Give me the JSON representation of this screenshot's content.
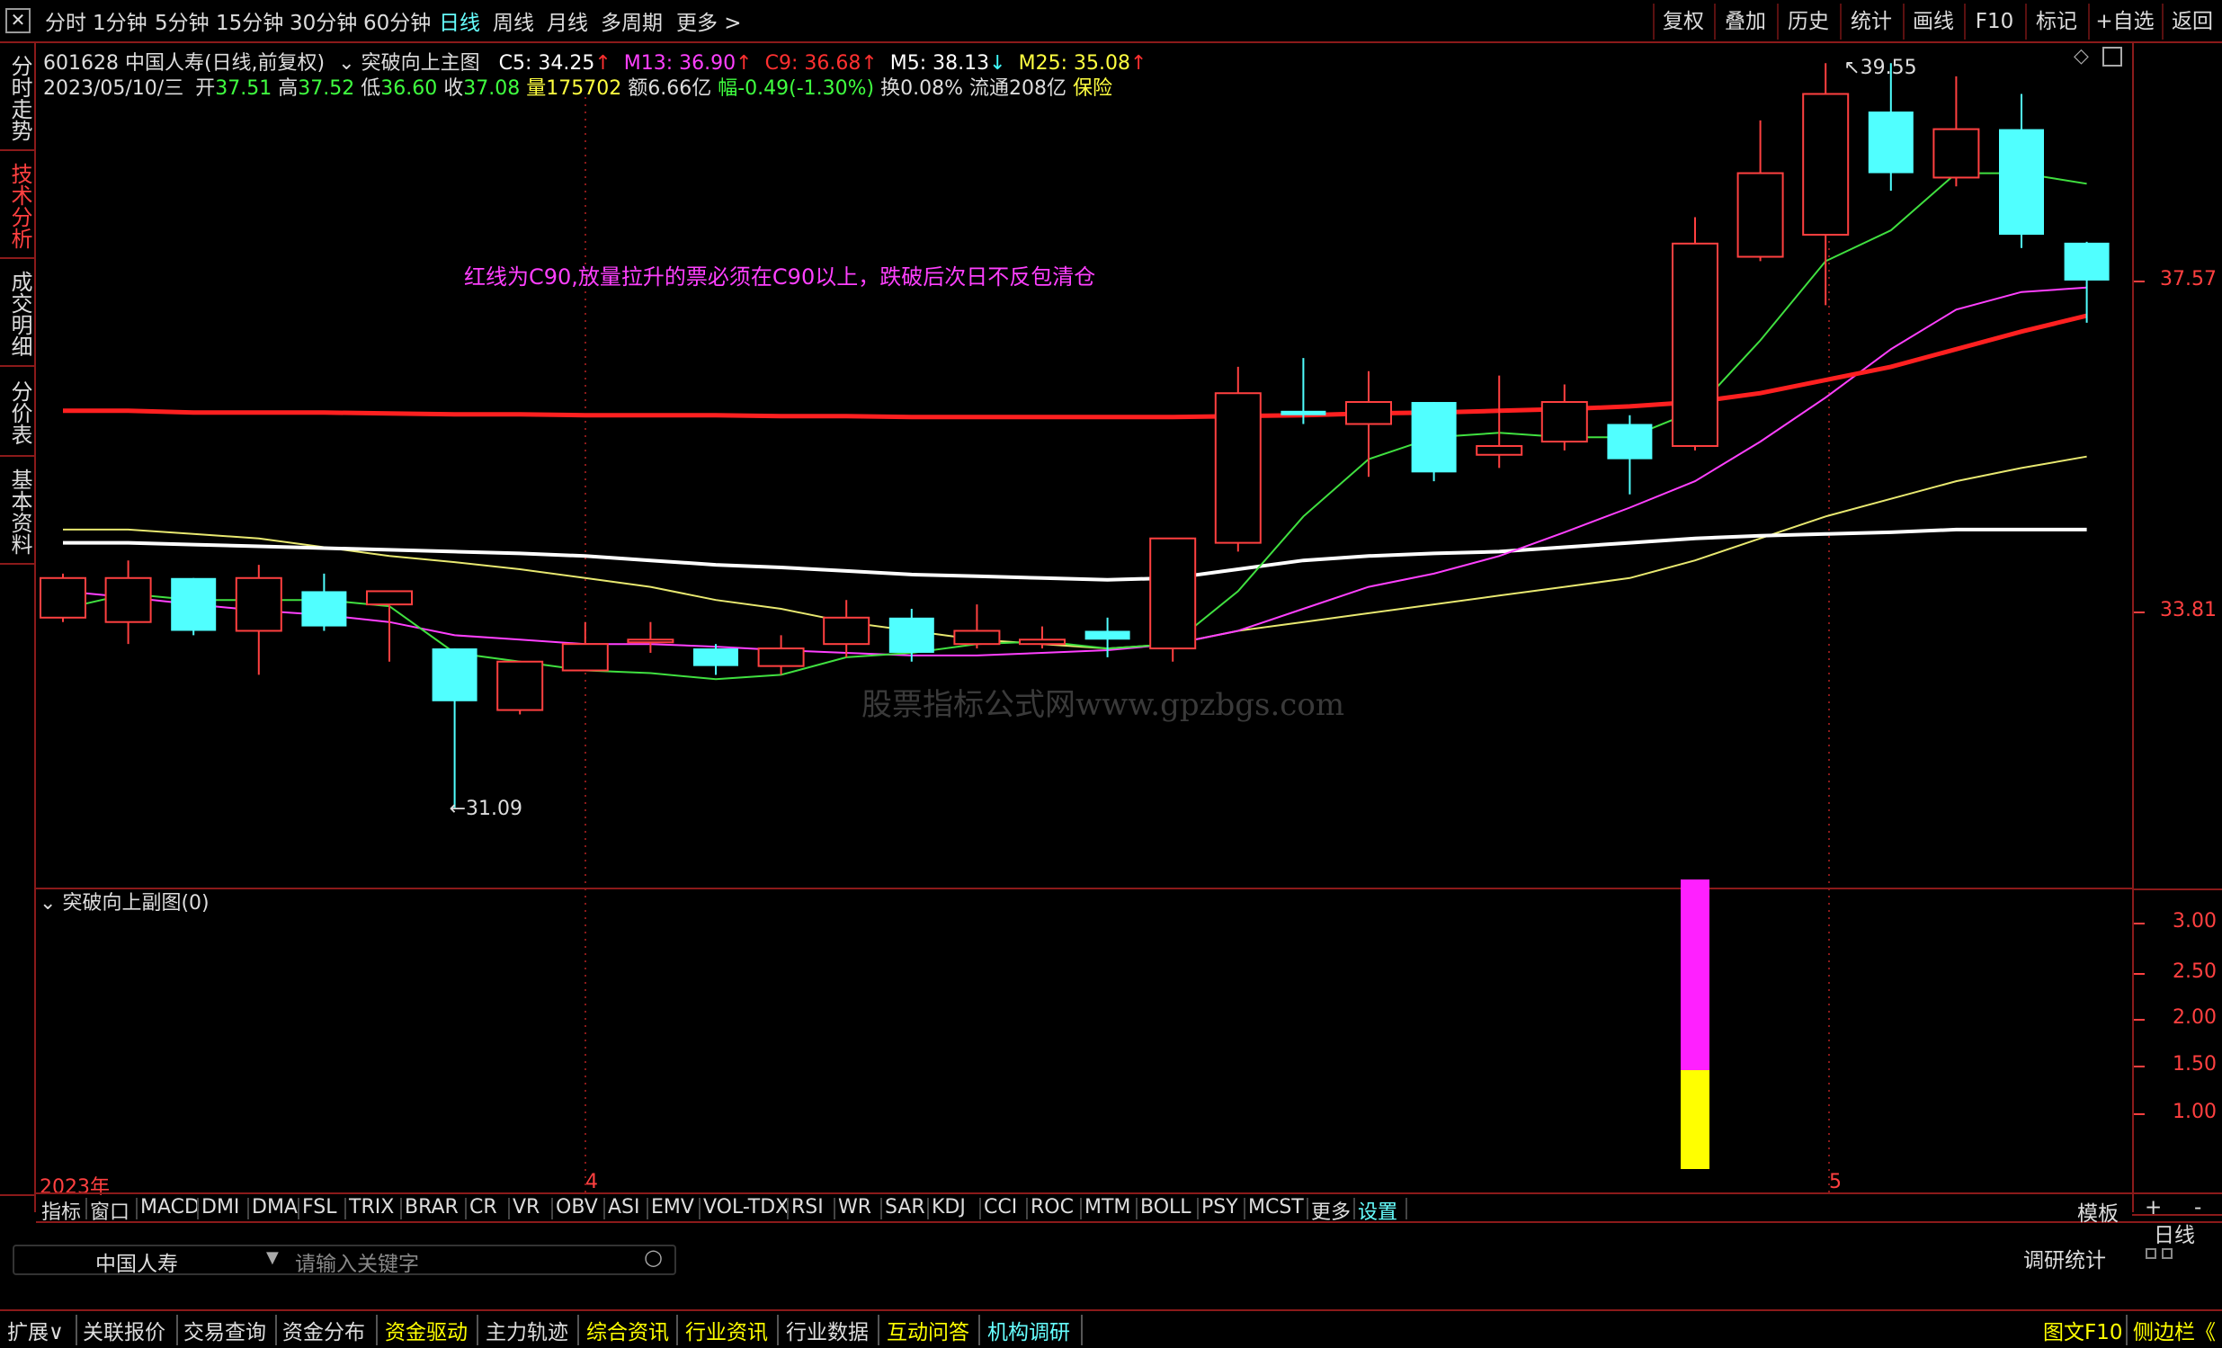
{
  "toolbar": {
    "close_label": "✕",
    "periods": [
      "分时",
      "1分钟",
      "5分钟",
      "15分钟",
      "30分钟",
      "60分钟",
      "日线",
      "周线",
      "月线",
      "多周期",
      "更多 >"
    ],
    "active_period": "日线",
    "right_buttons": [
      "复权",
      "叠加",
      "历史",
      "统计",
      "画线",
      "F10",
      "标记",
      "+自选",
      "返回"
    ]
  },
  "left_tabs": [
    "分时走势",
    "技术分析",
    "成交明细",
    "分价表",
    "基本资料"
  ],
  "active_left_tab": "技术分析",
  "header": {
    "stock": "601628 中国人寿(日线,前复权)",
    "main_chart_name": "突破向上主图",
    "ma": [
      {
        "text": "C5: 34.25",
        "arrow": "↑",
        "color": "#ffffff"
      },
      {
        "text": "M13: 36.90",
        "arrow": "↑",
        "color": "#ff40ff"
      },
      {
        "text": "C9: 36.68",
        "arrow": "↑",
        "color": "#ff3030"
      },
      {
        "text": "M5: 38.13",
        "arrow": "↓",
        "color": "#ffffff"
      },
      {
        "text": "M25: 35.08",
        "arrow": "↑",
        "color": "#ffff40"
      }
    ],
    "date": "2023/05/10/三",
    "open_label": "开",
    "open": "37.51",
    "high_label": "高",
    "high": "37.52",
    "low_label": "低",
    "low": "36.60",
    "close_label": "收",
    "close": "37.08",
    "vol_label": "量",
    "vol": "175702",
    "amount": "额6.66亿",
    "change": "幅-0.49(-1.30%)",
    "turnover": "换0.08%",
    "float": "流通208亿",
    "sector": "保险"
  },
  "annotation": "红线为C90,放量拉升的票必须在C90以上，跌破后次日不反包清仓",
  "watermark": "股票指标公式网www.gpzbgs.com",
  "high_mark": "39.55",
  "low_mark": "31.09",
  "main_axis_labels": [
    "37.57",
    "33.81"
  ],
  "sub_chart_title": "突破向上副图(0)",
  "sub_axis_labels": [
    "3.00",
    "2.50",
    "2.00",
    "1.50",
    "1.00"
  ],
  "time_labels": [
    "2023年",
    "4",
    "5"
  ],
  "period_label_right": "日线",
  "indicators": [
    "指标",
    "窗口",
    "MACD",
    "DMI",
    "DMA",
    "FSL",
    "TRIX",
    "BRAR",
    "CR",
    "VR",
    "OBV",
    "ASI",
    "EMV",
    "VOL-TDX",
    "RSI",
    "WR",
    "SAR",
    "KDJ",
    "CCI",
    "ROC",
    "MTM",
    "BOLL",
    "PSY",
    "MCST",
    "更多",
    "设置"
  ],
  "template_label": "模板",
  "plus_label": "+",
  "minus_label": "-",
  "search": {
    "stock_name": "中国人寿",
    "placeholder": "请输入关键字",
    "right_label": "调研统计"
  },
  "bottom_tabs": [
    "扩展∨",
    "关联报价",
    "交易查询",
    "资金分布",
    "资金驱动",
    "主力轨迹",
    "综合资讯",
    "行业资讯",
    "行业数据",
    "互动问答",
    "机构调研"
  ],
  "bottom_right": [
    "图文F10",
    "侧边栏《"
  ],
  "chart_data": {
    "type": "candlestick",
    "candles": [
      {
        "o": 33.25,
        "c": 33.7,
        "h": 33.75,
        "l": 33.2
      },
      {
        "o": 33.2,
        "c": 33.7,
        "h": 33.9,
        "l": 32.95
      },
      {
        "o": 33.7,
        "c": 33.1,
        "h": 33.7,
        "l": 33.05
      },
      {
        "o": 33.1,
        "c": 33.7,
        "h": 33.85,
        "l": 32.6
      },
      {
        "o": 33.55,
        "c": 33.15,
        "h": 33.75,
        "l": 33.1
      },
      {
        "o": 33.4,
        "c": 33.55,
        "h": 33.55,
        "l": 32.75
      },
      {
        "o": 32.9,
        "c": 32.3,
        "h": 32.9,
        "l": 31.09
      },
      {
        "o": 32.2,
        "c": 32.75,
        "h": 32.75,
        "l": 32.15
      },
      {
        "o": 32.65,
        "c": 32.95,
        "h": 33.2,
        "l": 32.65
      },
      {
        "o": 33.0,
        "c": 33.0,
        "h": 33.2,
        "l": 32.85
      },
      {
        "o": 32.9,
        "c": 32.7,
        "h": 32.95,
        "l": 32.6
      },
      {
        "o": 32.7,
        "c": 32.9,
        "h": 33.05,
        "l": 32.6
      },
      {
        "o": 32.95,
        "c": 33.25,
        "h": 33.45,
        "l": 32.8
      },
      {
        "o": 33.25,
        "c": 32.85,
        "h": 33.35,
        "l": 32.75
      },
      {
        "o": 32.95,
        "c": 33.1,
        "h": 33.4,
        "l": 32.9
      },
      {
        "o": 32.95,
        "c": 33.0,
        "h": 33.15,
        "l": 32.9
      },
      {
        "o": 33.1,
        "c": 33.0,
        "h": 33.25,
        "l": 32.8
      },
      {
        "o": 32.9,
        "c": 34.15,
        "h": 34.15,
        "l": 32.75
      },
      {
        "o": 34.1,
        "c": 35.8,
        "h": 36.1,
        "l": 34.0
      },
      {
        "o": 35.6,
        "c": 35.55,
        "h": 36.2,
        "l": 35.45
      },
      {
        "o": 35.45,
        "c": 35.7,
        "h": 36.05,
        "l": 34.85
      },
      {
        "o": 35.7,
        "c": 34.9,
        "h": 35.7,
        "l": 34.8
      },
      {
        "o": 35.1,
        "c": 35.2,
        "h": 36.0,
        "l": 34.95
      },
      {
        "o": 35.25,
        "c": 35.7,
        "h": 35.9,
        "l": 35.15
      },
      {
        "o": 35.45,
        "c": 35.05,
        "h": 35.55,
        "l": 34.65
      },
      {
        "o": 35.2,
        "c": 37.5,
        "h": 37.8,
        "l": 35.15
      },
      {
        "o": 37.35,
        "c": 38.3,
        "h": 38.9,
        "l": 37.3
      },
      {
        "o": 37.6,
        "c": 39.2,
        "h": 39.55,
        "l": 36.8
      },
      {
        "o": 39.0,
        "c": 38.3,
        "h": 39.55,
        "l": 38.1
      },
      {
        "o": 38.25,
        "c": 38.8,
        "h": 39.4,
        "l": 38.15
      },
      {
        "o": 38.8,
        "c": 37.6,
        "h": 39.2,
        "l": 37.45
      },
      {
        "o": 37.51,
        "c": 37.08,
        "h": 37.52,
        "l": 36.6
      }
    ],
    "ma_green": [
      33.35,
      33.52,
      33.45,
      33.45,
      33.45,
      33.38,
      32.85,
      32.75,
      32.65,
      32.62,
      32.55,
      32.6,
      32.8,
      32.85,
      32.95,
      32.98,
      32.9,
      32.95,
      33.55,
      34.4,
      35.05,
      35.3,
      35.35,
      35.3,
      35.3,
      35.6,
      36.4,
      37.3,
      37.65,
      38.3,
      38.3,
      38.18
    ],
    "ma_magenta": [
      33.55,
      33.48,
      33.4,
      33.33,
      33.28,
      33.2,
      33.05,
      33.0,
      32.95,
      32.95,
      32.92,
      32.88,
      32.85,
      32.82,
      32.82,
      32.85,
      32.88,
      32.95,
      33.1,
      33.35,
      33.6,
      33.75,
      33.95,
      34.22,
      34.5,
      34.8,
      35.25,
      35.75,
      36.3,
      36.75,
      36.95,
      37.0
    ],
    "ma_red": [
      35.6,
      35.6,
      35.58,
      35.58,
      35.58,
      35.57,
      35.56,
      35.56,
      35.55,
      35.55,
      35.55,
      35.54,
      35.54,
      35.53,
      35.53,
      35.53,
      35.53,
      35.53,
      35.54,
      35.55,
      35.57,
      35.58,
      35.6,
      35.62,
      35.65,
      35.7,
      35.8,
      35.95,
      36.1,
      36.3,
      36.5,
      36.68
    ],
    "ma_yellow": [
      34.25,
      34.25,
      34.2,
      34.15,
      34.05,
      33.95,
      33.88,
      33.8,
      33.7,
      33.6,
      33.45,
      33.35,
      33.2,
      33.1,
      33.0,
      32.95,
      32.9,
      32.95,
      33.1,
      33.2,
      33.3,
      33.4,
      33.5,
      33.6,
      33.7,
      33.9,
      34.15,
      34.4,
      34.6,
      34.8,
      34.95,
      35.08
    ],
    "ma_white": [
      34.1,
      34.1,
      34.08,
      34.06,
      34.04,
      34.02,
      34.0,
      33.98,
      33.95,
      33.9,
      33.85,
      33.82,
      33.78,
      33.74,
      33.72,
      33.7,
      33.68,
      33.7,
      33.8,
      33.9,
      33.95,
      33.98,
      34.0,
      34.05,
      34.1,
      34.15,
      34.18,
      34.2,
      34.22,
      34.25,
      34.25,
      34.25
    ],
    "y_range": [
      30.5,
      40.0
    ],
    "sub_chart": {
      "type": "bar",
      "ylim": [
        0.3,
        3.15
      ],
      "bar_index": 25,
      "magenta_top": 3.0,
      "magenta_bottom": 1.0,
      "yellow_top": 1.0,
      "yellow_bottom": 0.0
    }
  }
}
